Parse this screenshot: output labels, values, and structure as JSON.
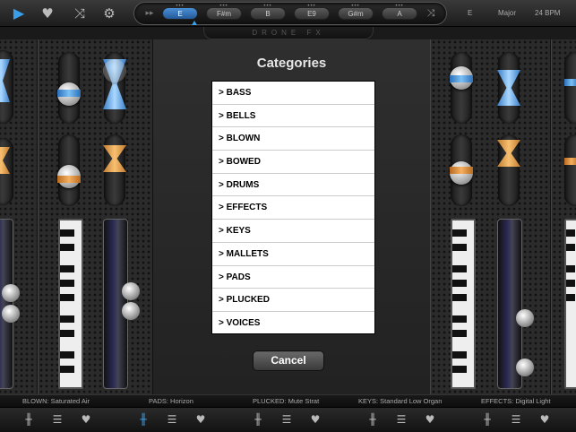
{
  "topbar": {
    "keys": [
      {
        "label": "E",
        "active": true
      },
      {
        "label": "F#m",
        "active": false
      },
      {
        "label": "B",
        "active": false
      },
      {
        "label": "E9",
        "active": false
      },
      {
        "label": "G#m",
        "active": false
      },
      {
        "label": "A",
        "active": false
      }
    ],
    "key_label": "E",
    "scale_label": "Major",
    "tempo_label": "24 BPM",
    "drone_label": "DRONE FX",
    "accent": "#3a9ee8"
  },
  "modal": {
    "title": "Categories",
    "items": [
      "> BASS",
      "> BELLS",
      "> BLOWN",
      "> BOWED",
      "> DRUMS",
      "> EFFECTS",
      "> KEYS",
      "> MALLETS",
      "> PADS",
      "> PLUCKED",
      "> VOICES"
    ],
    "cancel_label": "Cancel"
  },
  "status": {
    "channels": [
      "BLOWN: Saturated Air",
      "PADS: Horizon",
      "PLUCKED: Mute Strat",
      "KEYS: Standard Low Organ",
      "EFFECTS: Digital Light"
    ]
  }
}
